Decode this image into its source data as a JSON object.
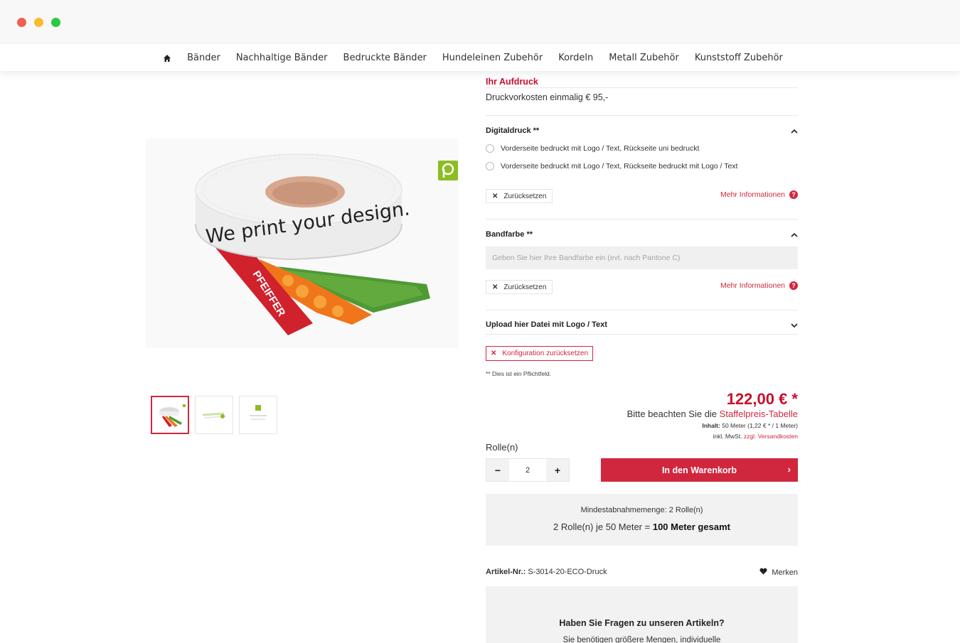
{
  "nav": {
    "items": [
      "Bänder",
      "Nachhaltige Bänder",
      "Bedruckte Bänder",
      "Hundeleinen Zubehör",
      "Kordeln",
      "Metall Zubehör",
      "Kunststoff Zubehör"
    ]
  },
  "product_image": {
    "roll_text": "We print your design.",
    "ribbon_brand": "PFEIFFER"
  },
  "aufdruck": {
    "title": "Ihr Aufdruck",
    "kosten": "Druckvorkosten einmalig € 95,-"
  },
  "digitaldruck": {
    "title": "Digitaldruck **",
    "options": [
      "Vorderseite bedruckt mit Logo / Text, Rückseite uni bedruckt",
      "Vorderseite bedruckt mit Logo / Text, Rückseite bedruckt mit Logo / Text"
    ],
    "reset_label": "Zurücksetzen",
    "more_info_label": "Mehr Informationen"
  },
  "bandfarbe": {
    "title": "Bandfarbe **",
    "placeholder": "Geben Sie hier Ihre Bandfarbe ein (evt. nach Pantone C)",
    "reset_label": "Zurücksetzen",
    "more_info_label": "Mehr Informationen"
  },
  "upload": {
    "title": "Upload hier Datei mit Logo / Text"
  },
  "config_reset_label": "Konfiguration zurücksetzen",
  "required_note": "** Dies ist ein Pflichtfeld.",
  "pricing": {
    "price": "122,00 € *",
    "staffel_prefix": "Bitte beachten Sie die",
    "staffel_link": "Staffelpreis-Tabelle",
    "inhalt_label": "Inhalt:",
    "inhalt_value": "50 Meter (1,22 € * / 1 Meter)",
    "mwst_prefix": "inkl. MwSt.",
    "versand_link": "zzgl. Versandkosten"
  },
  "quantity": {
    "label": "Rolle(n)",
    "value": "2",
    "minus": "−",
    "plus": "+"
  },
  "cart_button": "In den Warenkorb",
  "min_box": {
    "line1": "Mindestabnahmemenge: 2 Rolle(n)",
    "line2_prefix": "2 Rolle(n) je 50 Meter =",
    "line2_bold": "100 Meter gesamt"
  },
  "article": {
    "label": "Artikel-Nr.:",
    "value": "S-3014-20-ECO-Druck",
    "merken": "Merken"
  },
  "faq": {
    "title": "Haben Sie Fragen zu unseren Artikeln?",
    "sub": "Sie benötigen größere Mengen, individuelle"
  },
  "colors": {
    "accent": "#d0273e",
    "price": "#c8102e",
    "badge_green": "#8cbd23"
  }
}
